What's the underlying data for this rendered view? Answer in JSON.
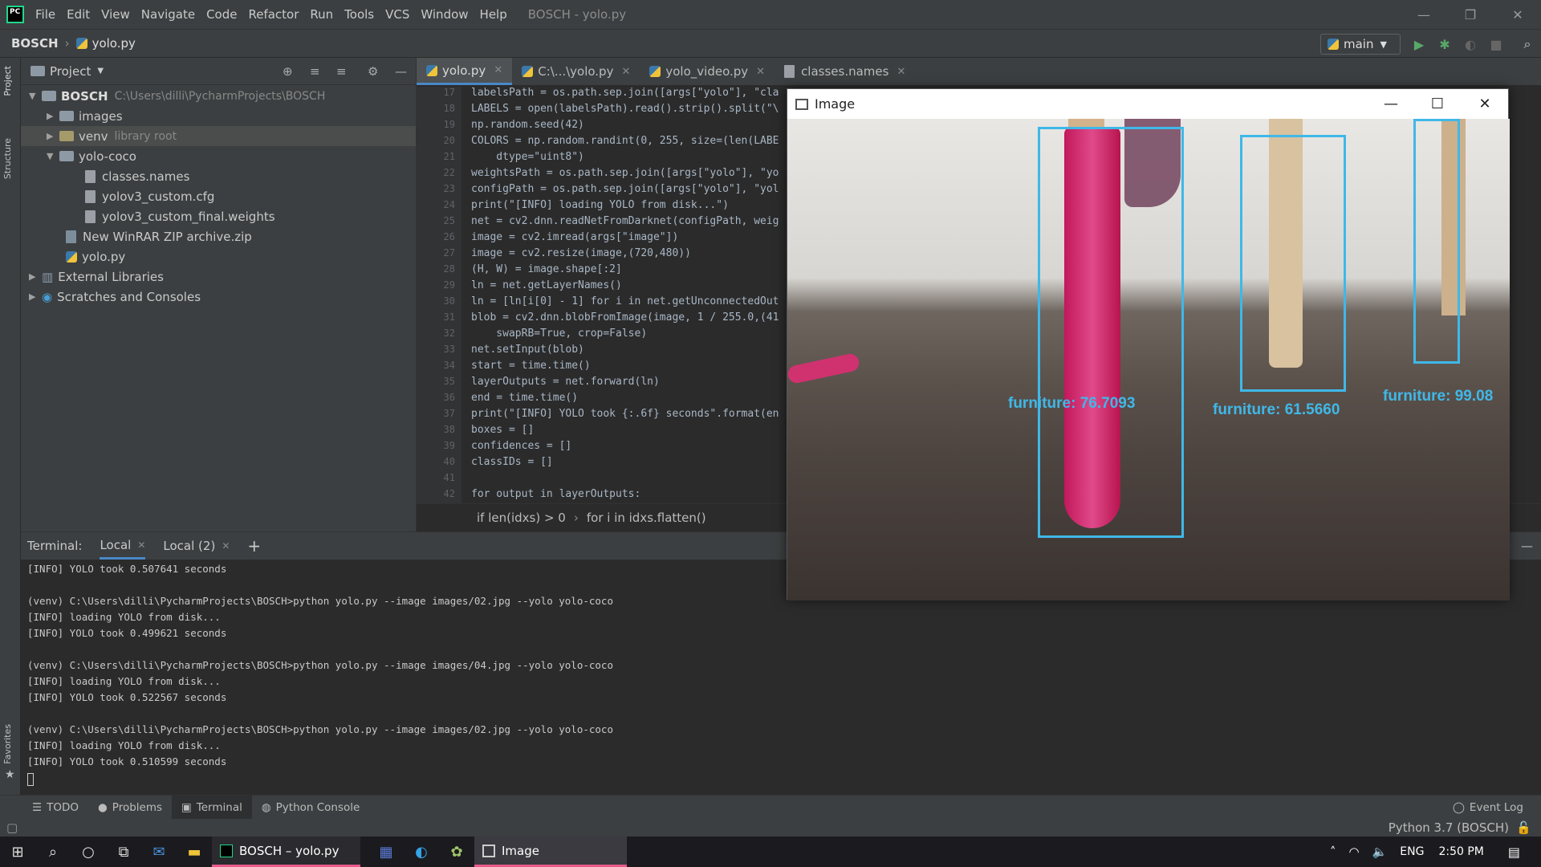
{
  "menubar": {
    "logo": "PC",
    "items": [
      "File",
      "Edit",
      "View",
      "Navigate",
      "Code",
      "Refactor",
      "Run",
      "Tools",
      "VCS",
      "Window",
      "Help"
    ],
    "title": "BOSCH - yolo.py"
  },
  "navbar": {
    "project": "BOSCH",
    "file": "yolo.py",
    "run_config": "main"
  },
  "left_strip": {
    "project": "Project",
    "structure": "Structure",
    "favorites": "Favorites"
  },
  "project_panel": {
    "header": "Project",
    "tree": [
      {
        "label": "BOSCH",
        "extra": "C:\\Users\\dilli\\PycharmProjects\\BOSCH"
      },
      {
        "label": "images",
        "extra": ""
      },
      {
        "label": "venv",
        "extra": "library root"
      },
      {
        "label": "yolo-coco",
        "extra": ""
      },
      {
        "label": "classes.names",
        "extra": ""
      },
      {
        "label": "yolov3_custom.cfg",
        "extra": ""
      },
      {
        "label": "yolov3_custom_final.weights",
        "extra": ""
      },
      {
        "label": "New WinRAR ZIP archive.zip",
        "extra": ""
      },
      {
        "label": "yolo.py",
        "extra": ""
      },
      {
        "label": "External Libraries",
        "extra": ""
      },
      {
        "label": "Scratches and Consoles",
        "extra": ""
      }
    ]
  },
  "editor": {
    "tabs": [
      "yolo.py",
      "C:\\...\\yolo.py",
      "yolo_video.py",
      "classes.names"
    ],
    "line_numbers": [
      "17",
      "18",
      "19",
      "20",
      "21",
      "22",
      "23",
      "24",
      "25",
      "26",
      "27",
      "28",
      "29",
      "30",
      "31",
      "32",
      "33",
      "34",
      "35",
      "36",
      "37",
      "38",
      "39",
      "40",
      "41",
      "42"
    ],
    "code_lines": [
      "labelsPath = os.path.sep.join([args[\"yolo\"], \"cla",
      "LABELS = open(labelsPath).read().strip().split(\"\\",
      "np.random.seed(42)",
      "COLORS = np.random.randint(0, 255, size=(len(LABE",
      "    dtype=\"uint8\")",
      "weightsPath = os.path.sep.join([args[\"yolo\"], \"yo",
      "configPath = os.path.sep.join([args[\"yolo\"], \"yol",
      "print(\"[INFO] loading YOLO from disk...\")",
      "net = cv2.dnn.readNetFromDarknet(configPath, weig",
      "image = cv2.imread(args[\"image\"])",
      "image = cv2.resize(image,(720,480))",
      "(H, W) = image.shape[:2]",
      "ln = net.getLayerNames()",
      "ln = [ln[i[0] - 1] for i in net.getUnconnectedOut",
      "blob = cv2.dnn.blobFromImage(image, 1 / 255.0,(41",
      "    swapRB=True, crop=False)",
      "net.setInput(blob)",
      "start = time.time()",
      "layerOutputs = net.forward(ln)",
      "end = time.time()",
      "print(\"[INFO] YOLO took {:.6f} seconds\".format(en",
      "boxes = []",
      "confidences = []",
      "classIDs = []",
      "",
      "for output in layerOutputs:"
    ],
    "breadcrumb": [
      "if len(idxs) > 0",
      "for i in idxs.flatten()"
    ]
  },
  "terminal": {
    "label": "Terminal:",
    "tabs": [
      "Local",
      "Local (2)"
    ],
    "add": "+",
    "lines": [
      "[INFO] YOLO took 0.507641 seconds",
      "",
      "(venv) C:\\Users\\dilli\\PycharmProjects\\BOSCH>python yolo.py --image images/02.jpg --yolo yolo-coco",
      "[INFO] loading YOLO from disk...",
      "[INFO] YOLO took 0.499621 seconds",
      "",
      "(venv) C:\\Users\\dilli\\PycharmProjects\\BOSCH>python yolo.py --image images/04.jpg --yolo yolo-coco",
      "[INFO] loading YOLO from disk...",
      "[INFO] YOLO took 0.522567 seconds",
      "",
      "(venv) C:\\Users\\dilli\\PycharmProjects\\BOSCH>python yolo.py --image images/02.jpg --yolo yolo-coco",
      "[INFO] loading YOLO from disk...",
      "[INFO] YOLO took 0.510599 seconds"
    ]
  },
  "bottom_tabs": {
    "todo": "TODO",
    "problems": "Problems",
    "terminal": "Terminal",
    "python_console": "Python Console",
    "event_log": "Event Log"
  },
  "status": {
    "interpreter": "Python 3.7 (BOSCH)"
  },
  "image_window": {
    "title": "Image",
    "detections": [
      {
        "label": "furniture: 76.7093"
      },
      {
        "label": "furniture: 61.5660"
      },
      {
        "label": "furniture: 99.08"
      }
    ],
    "box_color": "#3fb8e8"
  },
  "taskbar": {
    "apps": [
      "BOSCH – yolo.py",
      "Image"
    ],
    "lang": "ENG",
    "time": "2:50 PM"
  }
}
